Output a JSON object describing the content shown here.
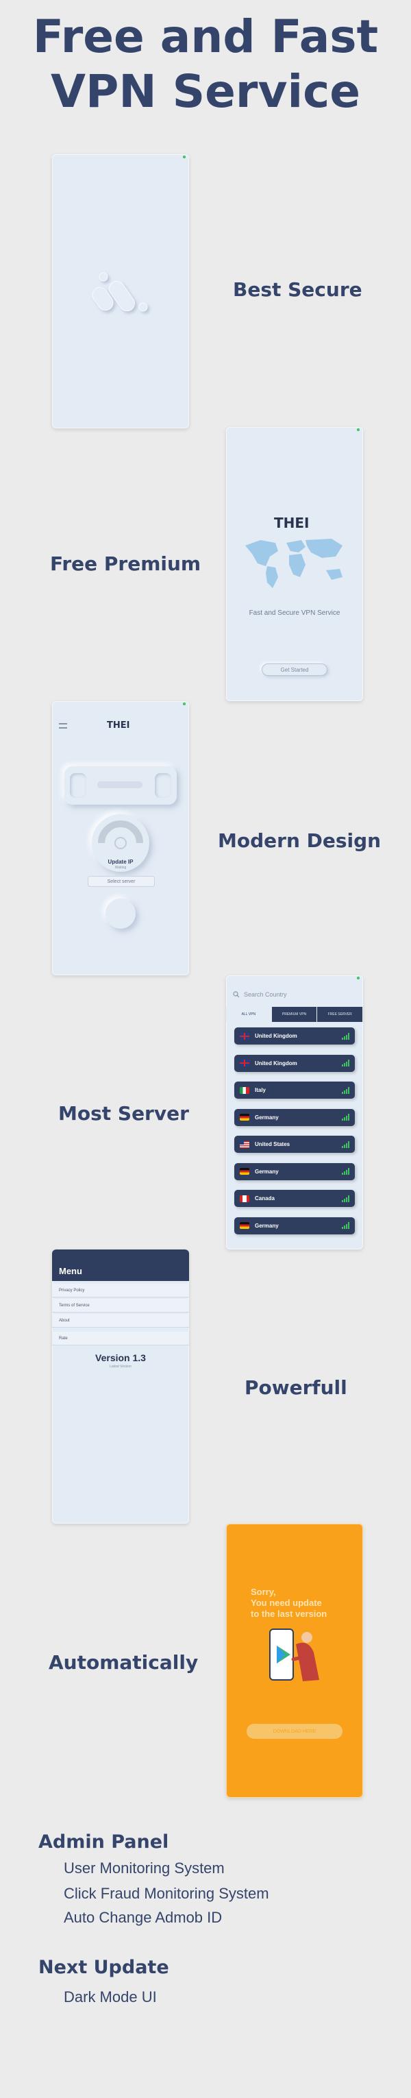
{
  "hero": {
    "line1": "Free and Fast",
    "line2": "VPN Service"
  },
  "features": [
    {
      "label": "Best Secure"
    },
    {
      "label": "Free Premium"
    },
    {
      "label": "Modern Design"
    },
    {
      "label": "Most Server"
    },
    {
      "label": "Powerfull"
    },
    {
      "label": "Automatically"
    }
  ],
  "screen2": {
    "brand": "THEI",
    "tagline": "Fast and Secure VPN Service",
    "button": "Get Started"
  },
  "screen3": {
    "brand": "THEI",
    "status_title": "Update IP",
    "status_sub": "Waiting",
    "select_label": "Select server"
  },
  "screen4": {
    "search_placeholder": "Search Country",
    "tabs": [
      "ALL VPN",
      "PREMIUM VPN",
      "FREE SERVER"
    ],
    "servers": [
      {
        "country": "United Kingdom",
        "flag": "uk"
      },
      {
        "country": "United Kingdom",
        "flag": "uk"
      },
      {
        "country": "Italy",
        "flag": "it"
      },
      {
        "country": "Germany",
        "flag": "de"
      },
      {
        "country": "United States",
        "flag": "us"
      },
      {
        "country": "Germany",
        "flag": "de"
      },
      {
        "country": "Canada",
        "flag": "ca"
      },
      {
        "country": "Germany",
        "flag": "de"
      }
    ]
  },
  "screen5": {
    "title": "Menu",
    "items": [
      "Privacy Policy",
      "Terms of Service",
      "About",
      "Rate"
    ],
    "version": "Version 1.3",
    "version_sub": "Latest Version"
  },
  "screen6": {
    "line1": "Sorry,",
    "line2": "You need update",
    "line3": "to the last version",
    "button": "DOWNLOAD HERE"
  },
  "admin": {
    "heading": "Admin Panel",
    "items": [
      "User Monitoring System",
      "Click Fraud Monitoring System",
      "Auto Change Admob ID"
    ]
  },
  "next": {
    "heading": "Next Update",
    "items": [
      "Dark Mode UI"
    ]
  },
  "colors": {
    "navy": "#2f3d5f",
    "background": "#ebebeb",
    "screen": "#e3ebf5",
    "orange": "#f9a11b",
    "signal": "#3fc35f"
  }
}
